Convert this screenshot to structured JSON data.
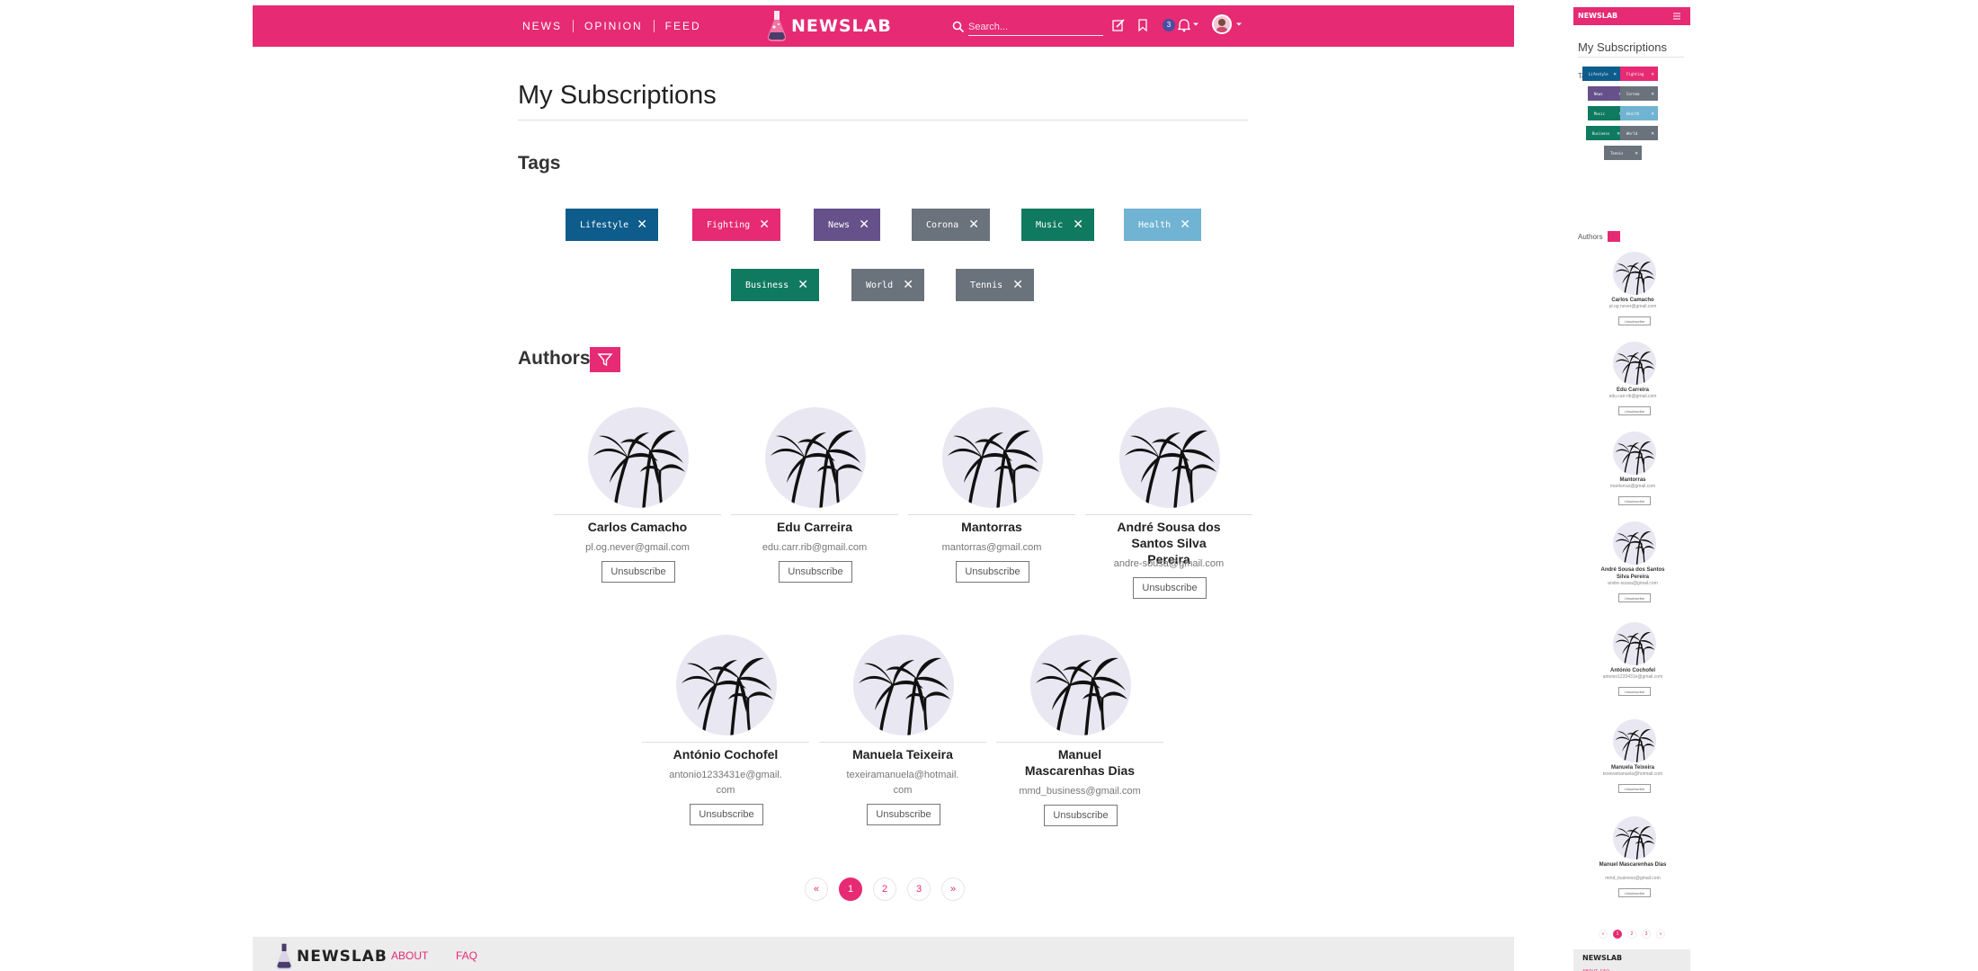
{
  "nav": {
    "links": [
      "NEWS",
      "OPINION",
      "FEED"
    ],
    "brand": "NEWSLAB",
    "search_placeholder": "Search...",
    "notification_count": "3"
  },
  "page": {
    "title": "My Subscriptions"
  },
  "tags_section": {
    "heading": "Tags",
    "tags": [
      {
        "label": "Lifestyle",
        "color": "#0d5c8c"
      },
      {
        "label": "Fighting",
        "color": "#e62a73"
      },
      {
        "label": "News",
        "color": "#66518a"
      },
      {
        "label": "Corona",
        "color": "#6a737c"
      },
      {
        "label": "Music",
        "color": "#0f7a5f"
      },
      {
        "label": "Health",
        "color": "#70b3d2"
      },
      {
        "label": "Business",
        "color": "#0f7a5f"
      },
      {
        "label": "World",
        "color": "#6a737c"
      },
      {
        "label": "Tennis",
        "color": "#6a737c"
      }
    ]
  },
  "authors_section": {
    "heading": "Authors",
    "unsubscribe_label": "Unsubscribe",
    "authors": [
      {
        "name": "Carlos Camacho",
        "email": "pl.og.never@gmail.com"
      },
      {
        "name": "Edu Carreira",
        "email": "edu.carr.rib@gmail.com"
      },
      {
        "name": "Mantorras",
        "email": "mantorras@gmail.com"
      },
      {
        "name": "André Sousa dos Santos Silva Pereira",
        "email": "andre-sousa@gmail.com"
      },
      {
        "name": "António Cochofel",
        "email": "antonio1233431e@gmail.com"
      },
      {
        "name": "Manuela Teixeira",
        "email": "texeiramanuela@hotmail.com"
      },
      {
        "name": "Manuel Mascarenhas Dias",
        "email": "mmd_business@gmail.com"
      }
    ]
  },
  "pagination": {
    "prev": "«",
    "pages": [
      "1",
      "2",
      "3"
    ],
    "next": "»",
    "current": "1"
  },
  "footer": {
    "brand": "NEWSLAB",
    "links": [
      "ABOUT",
      "FAQ"
    ]
  },
  "colors": {
    "accent": "#e62a73",
    "footer_bg": "#ececec"
  }
}
